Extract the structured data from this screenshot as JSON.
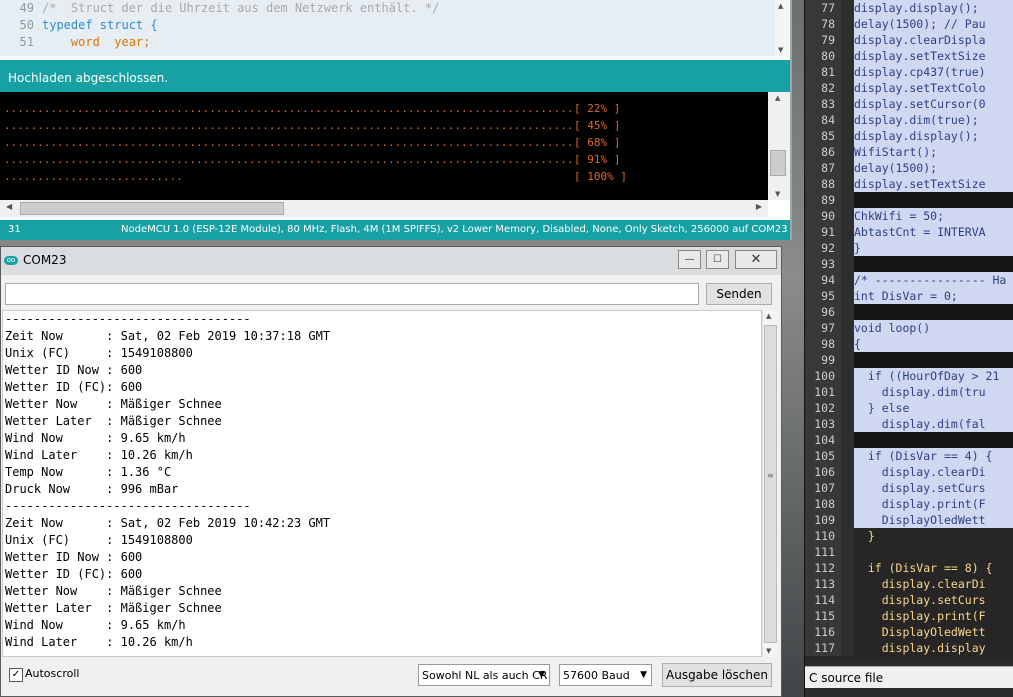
{
  "editor_right": {
    "lines": [
      {
        "n": "77",
        "t": "display.display();",
        "sel": true
      },
      {
        "n": "78",
        "t": "delay(1500); // Pau",
        "sel": true
      },
      {
        "n": "79",
        "t": "display.clearDispla",
        "sel": true
      },
      {
        "n": "80",
        "t": "display.setTextSize",
        "sel": true
      },
      {
        "n": "81",
        "t": "display.cp437(true)",
        "sel": true
      },
      {
        "n": "82",
        "t": "display.setTextColo",
        "sel": true
      },
      {
        "n": "83",
        "t": "display.setCursor(0",
        "sel": true
      },
      {
        "n": "84",
        "t": "display.dim(true);",
        "sel": true
      },
      {
        "n": "85",
        "t": "display.display();",
        "sel": true
      },
      {
        "n": "86",
        "t": "WifiStart();",
        "sel": true
      },
      {
        "n": "87",
        "t": "delay(1500);",
        "sel": true
      },
      {
        "n": "88",
        "t": "display.setTextSize",
        "sel": true
      },
      {
        "n": "89",
        "t": "",
        "sel": true
      },
      {
        "n": "90",
        "t": "ChkWifi = 50;",
        "sel": true
      },
      {
        "n": "91",
        "t": "AbtastCnt = INTERVA",
        "sel": true
      },
      {
        "n": "92",
        "t": "}",
        "sel": true
      },
      {
        "n": "93",
        "t": "",
        "sel": true
      },
      {
        "n": "94",
        "t": "/* ---------------- Ha",
        "sel": true
      },
      {
        "n": "95",
        "t": "int DisVar = 0;",
        "sel": true
      },
      {
        "n": "96",
        "t": "",
        "sel": true
      },
      {
        "n": "97",
        "t": "void loop()",
        "sel": true
      },
      {
        "n": "98",
        "t": "{",
        "sel": true
      },
      {
        "n": "99",
        "t": "",
        "sel": true
      },
      {
        "n": "100",
        "t": "  if ((HourOfDay > 21",
        "sel": true
      },
      {
        "n": "101",
        "t": "    display.dim(tru",
        "sel": true
      },
      {
        "n": "102",
        "t": "  } else",
        "sel": true
      },
      {
        "n": "103",
        "t": "    display.dim(fal",
        "sel": true
      },
      {
        "n": "104",
        "t": "",
        "sel": true
      },
      {
        "n": "105",
        "t": "  if (DisVar == 4) {",
        "sel": true
      },
      {
        "n": "106",
        "t": "    display.clearDi",
        "sel": true
      },
      {
        "n": "107",
        "t": "    display.setCurs",
        "sel": true
      },
      {
        "n": "108",
        "t": "    display.print(F",
        "sel": true
      },
      {
        "n": "109",
        "t": "    DisplayOledWett",
        "sel": true
      },
      {
        "n": "110",
        "t": "  }",
        "sel": false
      },
      {
        "n": "111",
        "t": "",
        "sel": false
      },
      {
        "n": "112",
        "t": "  if (DisVar == 8) {",
        "sel": false
      },
      {
        "n": "113",
        "t": "    display.clearDi",
        "sel": false
      },
      {
        "n": "114",
        "t": "    display.setCurs",
        "sel": false
      },
      {
        "n": "115",
        "t": "    display.print(F",
        "sel": false
      },
      {
        "n": "116",
        "t": "    DisplayOledWett",
        "sel": false
      },
      {
        "n": "117",
        "t": "    display.display",
        "sel": false
      }
    ],
    "status": "C source file"
  },
  "ide": {
    "code_lines": [
      {
        "n": "49",
        "t": "/*  Struct der die Uhrzeit aus dem Netzwerk enthält. */",
        "cls": "ct"
      },
      {
        "n": "50",
        "t": "typedef struct {",
        "cls": "kw"
      },
      {
        "n": "51",
        "t": "    word  year;",
        "cls": "ty"
      }
    ],
    "message": "Hochladen abgeschlossen.",
    "progress_lines": [
      {
        "dots": "......................................................................................",
        "pct": "[ 22% ]"
      },
      {
        "dots": "......................................................................................",
        "pct": "[ 45% ]"
      },
      {
        "dots": "......................................................................................",
        "pct": "[ 68% ]"
      },
      {
        "dots": "......................................................................................",
        "pct": "[ 91% ]"
      },
      {
        "dots": "...........................",
        "pct": "[ 100% ]"
      }
    ],
    "status_line": "31",
    "status_board": "NodeMCU 1.0 (ESP-12E Module), 80 MHz, Flash, 4M (1M SPIFFS), v2 Lower Memory, Disabled, None, Only Sketch, 256000 auf COM23"
  },
  "serial": {
    "title": "COM23",
    "logo": "oo",
    "input_value": "",
    "send_label": "Senden",
    "output_lines": [
      "----------------------------------",
      "Zeit Now      : Sat, 02 Feb 2019 10:37:18 GMT",
      "Unix (FC)     : 1549108800",
      "Wetter ID Now : 600",
      "Wetter ID (FC): 600",
      "Wetter Now    : Mäßiger Schnee",
      "Wetter Later  : Mäßiger Schnee",
      "Wind Now      : 9.65 km/h",
      "Wind Later    : 10.26 km/h",
      "Temp Now      : 1.36 °C",
      "Druck Now     : 996 mBar",
      "----------------------------------",
      "Zeit Now      : Sat, 02 Feb 2019 10:42:23 GMT",
      "Unix (FC)     : 1549108800",
      "Wetter ID Now : 600",
      "Wetter ID (FC): 600",
      "Wetter Now    : Mäßiger Schnee",
      "Wetter Later  : Mäßiger Schnee",
      "Wind Now      : 9.65 km/h",
      "Wind Later    : 10.26 km/h"
    ],
    "autoscroll_label": "Autoscroll",
    "autoscroll_checked": true,
    "line_ending": "Sowohl NL als auch CR",
    "baud": "57600 Baud",
    "clear_label": "Ausgabe löschen"
  }
}
